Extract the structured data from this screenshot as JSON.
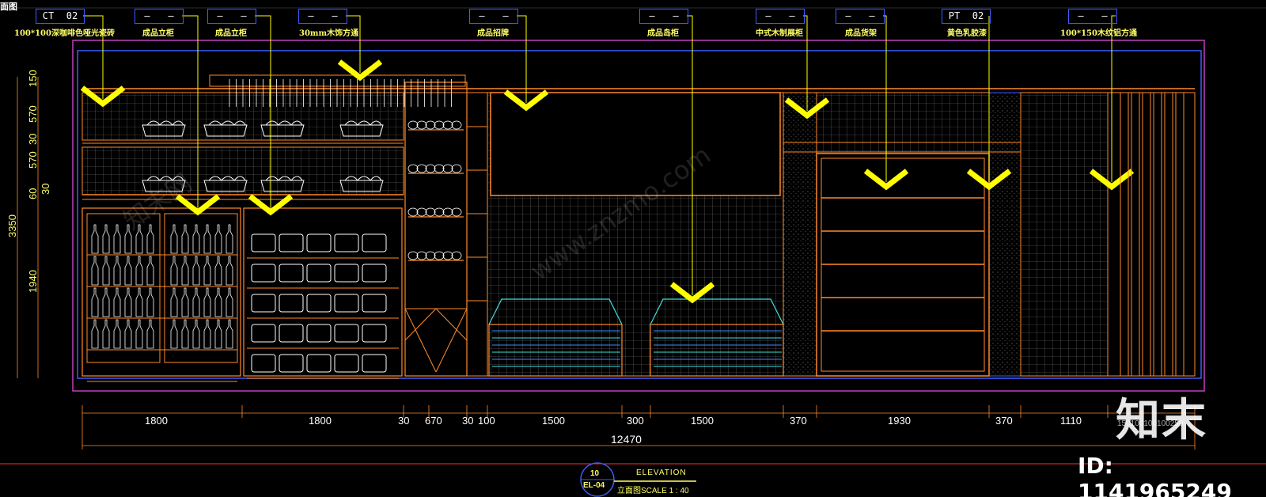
{
  "corner_label": "面图",
  "tags": [
    {
      "code": "CT",
      "num": "02",
      "label": "100*100深咖啡色哑光瓷砖"
    },
    {
      "code": "—",
      "num": "—",
      "label": "成品立柜"
    },
    {
      "code": "—",
      "num": "—",
      "label": "成品立柜"
    },
    {
      "code": "—",
      "num": "—",
      "label": "30mm木饰方通"
    },
    {
      "code": "—",
      "num": "—",
      "label": "成品招牌"
    },
    {
      "code": "—",
      "num": "—",
      "label": "成品岛柜"
    },
    {
      "code": "—",
      "num": "—",
      "label": "中式木制展柜"
    },
    {
      "code": "—",
      "num": "—",
      "label": "成品货架"
    },
    {
      "code": "PT",
      "num": "02",
      "label": "黄色乳胶漆"
    },
    {
      "code": "—",
      "num": "—",
      "label": "100*150木纹铝方通"
    }
  ],
  "vertical_dims": [
    "150",
    "570",
    "30",
    "570",
    "60",
    "30",
    "1940",
    "3350"
  ],
  "horizontal_dims": [
    "1800",
    "1800",
    "30",
    "670",
    "30",
    "100",
    "1500",
    "300",
    "1500",
    "370",
    "1930",
    "370",
    "1110"
  ],
  "overall_dim": "12470",
  "right_dim_text": "150100100100250",
  "title_block": {
    "number": "10",
    "code": "EL-04",
    "title": "ELEVATION",
    "subtitle": "立面图SCALE 1 : 40"
  },
  "watermark": {
    "logo": "知末",
    "id": "ID: 1141965249",
    "site": "www.znzmo.com",
    "brand": "知末网"
  },
  "colors": {
    "orange": "#ff8a2a",
    "yellow": "#ffff00",
    "blue": "#3d5cff",
    "magenta": "#c040c0",
    "white": "#ffffff",
    "grid": "#8a8a8a",
    "cyan": "#40e0e0"
  }
}
